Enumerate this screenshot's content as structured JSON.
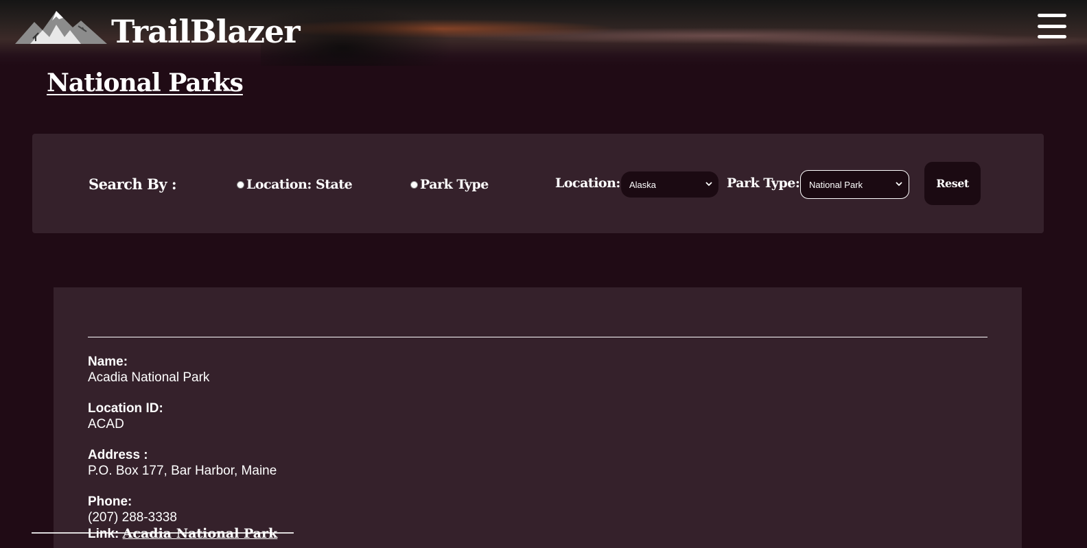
{
  "header": {
    "brand": "TrailBlazer"
  },
  "page": {
    "title": "National Parks"
  },
  "search": {
    "label": "Search By :",
    "options": [
      {
        "label": "Location: State"
      },
      {
        "label": "Park Type"
      }
    ],
    "location_label": "Location:",
    "location_value": "Alaska",
    "parktype_label": "Park Type:",
    "parktype_value": "National Park",
    "reset_label": "Reset"
  },
  "result": {
    "fields": [
      {
        "label": "Name:",
        "value": "Acadia National Park"
      },
      {
        "label": "Location ID:",
        "value": "ACAD"
      },
      {
        "label": "Address :",
        "value": "P.O. Box 177, Bar Harbor, Maine"
      },
      {
        "label": "Phone:",
        "value": "(207) 288-3338"
      }
    ],
    "link_prefix": "Link:",
    "link_text": "Acadia National Park"
  },
  "colors": {
    "background": "#200b15",
    "panel": "#35212b",
    "control": "#1b0a12",
    "text": "#ffffff"
  },
  "icons": [
    "mountain-logo-icon",
    "hamburger-menu-icon",
    "chevron-down-icon"
  ]
}
